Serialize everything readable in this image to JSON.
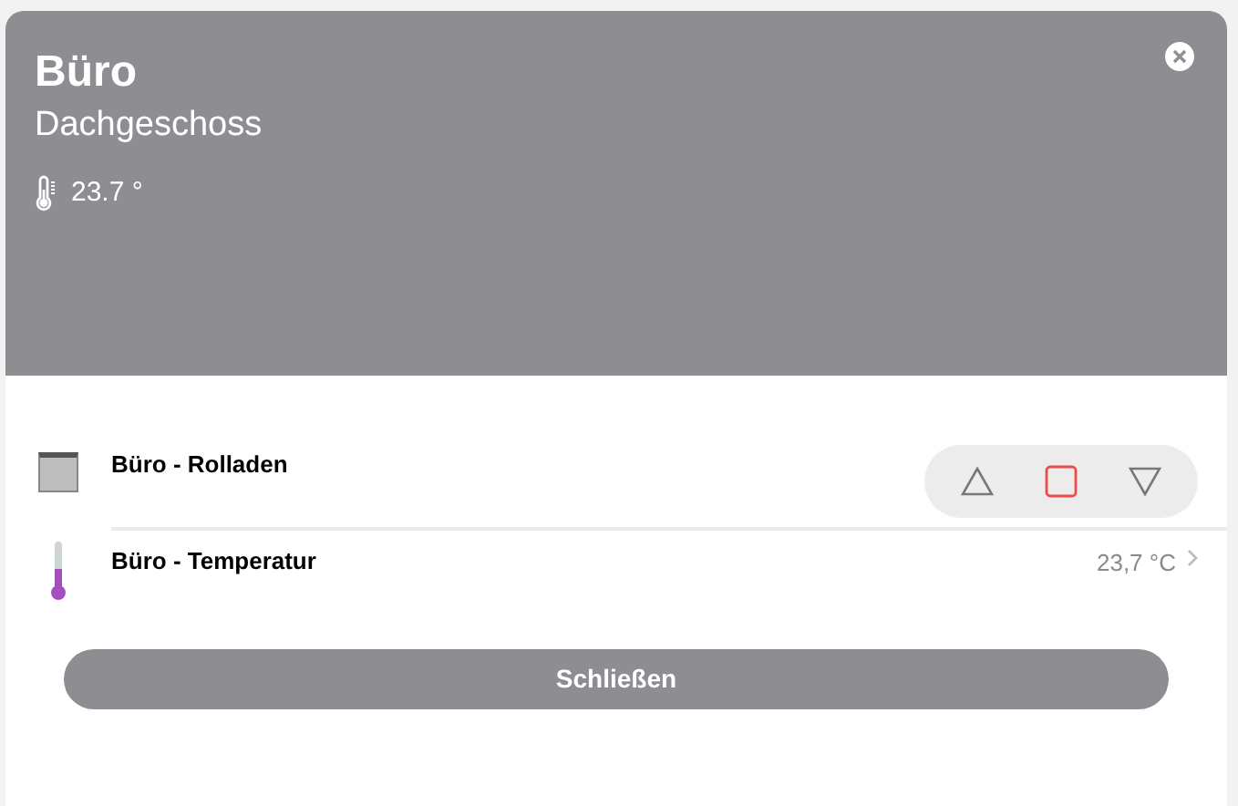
{
  "header": {
    "title": "Büro",
    "subtitle": "Dachgeschoss",
    "temperature": "23.7 °"
  },
  "items": [
    {
      "kind": "shutter",
      "label": "Büro - Rolladen"
    },
    {
      "kind": "sensor",
      "label": "Büro - Temperatur",
      "value": "23,7 °C"
    }
  ],
  "button": "Schließen"
}
